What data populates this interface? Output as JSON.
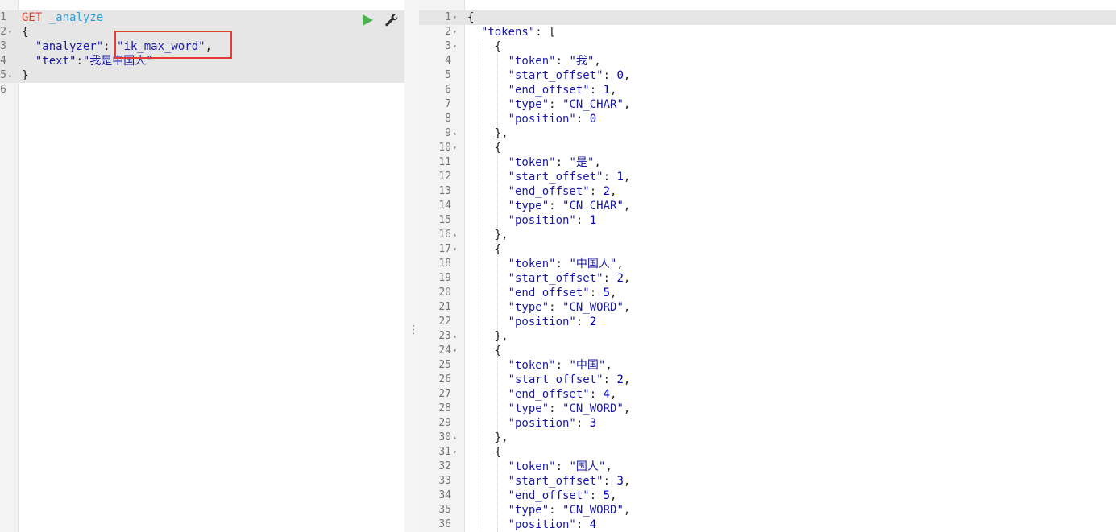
{
  "request": {
    "lines": [
      {
        "num": "1",
        "fold": "",
        "tokens": [
          [
            "method",
            "GET"
          ],
          [
            "punc",
            " "
          ],
          [
            "path",
            "_analyze"
          ]
        ]
      },
      {
        "num": "2",
        "fold": "▾",
        "tokens": [
          [
            "punc",
            "{"
          ]
        ]
      },
      {
        "num": "3",
        "fold": "",
        "tokens": [
          [
            "punc",
            "  "
          ],
          [
            "key",
            "\"analyzer\""
          ],
          [
            "punc",
            ": "
          ],
          [
            "str",
            "\"ik_max_word\""
          ],
          [
            "punc",
            ","
          ]
        ]
      },
      {
        "num": "4",
        "fold": "",
        "tokens": [
          [
            "punc",
            "  "
          ],
          [
            "key",
            "\"text\""
          ],
          [
            "punc",
            ":"
          ],
          [
            "str",
            "\"我是中国人\""
          ]
        ]
      },
      {
        "num": "5",
        "fold": "▴",
        "tokens": [
          [
            "punc",
            "}"
          ]
        ]
      },
      {
        "num": "6",
        "fold": "",
        "tokens": []
      }
    ]
  },
  "response": {
    "lines": [
      {
        "num": "1",
        "fold": "▾",
        "tokens": [
          [
            "punc",
            "{"
          ]
        ]
      },
      {
        "num": "2",
        "fold": "▾",
        "tokens": [
          [
            "punc",
            "  "
          ],
          [
            "key",
            "\"tokens\""
          ],
          [
            "punc",
            ": ["
          ]
        ]
      },
      {
        "num": "3",
        "fold": "▾",
        "tokens": [
          [
            "punc",
            "    {"
          ]
        ]
      },
      {
        "num": "4",
        "fold": "",
        "tokens": [
          [
            "punc",
            "      "
          ],
          [
            "key",
            "\"token\""
          ],
          [
            "punc",
            ": "
          ],
          [
            "str",
            "\"我\""
          ],
          [
            "punc",
            ","
          ]
        ]
      },
      {
        "num": "5",
        "fold": "",
        "tokens": [
          [
            "punc",
            "      "
          ],
          [
            "key",
            "\"start_offset\""
          ],
          [
            "punc",
            ": "
          ],
          [
            "num",
            "0"
          ],
          [
            "punc",
            ","
          ]
        ]
      },
      {
        "num": "6",
        "fold": "",
        "tokens": [
          [
            "punc",
            "      "
          ],
          [
            "key",
            "\"end_offset\""
          ],
          [
            "punc",
            ": "
          ],
          [
            "num",
            "1"
          ],
          [
            "punc",
            ","
          ]
        ]
      },
      {
        "num": "7",
        "fold": "",
        "tokens": [
          [
            "punc",
            "      "
          ],
          [
            "key",
            "\"type\""
          ],
          [
            "punc",
            ": "
          ],
          [
            "str",
            "\"CN_CHAR\""
          ],
          [
            "punc",
            ","
          ]
        ]
      },
      {
        "num": "8",
        "fold": "",
        "tokens": [
          [
            "punc",
            "      "
          ],
          [
            "key",
            "\"position\""
          ],
          [
            "punc",
            ": "
          ],
          [
            "num",
            "0"
          ]
        ]
      },
      {
        "num": "9",
        "fold": "▴",
        "tokens": [
          [
            "punc",
            "    },"
          ]
        ]
      },
      {
        "num": "10",
        "fold": "▾",
        "tokens": [
          [
            "punc",
            "    {"
          ]
        ]
      },
      {
        "num": "11",
        "fold": "",
        "tokens": [
          [
            "punc",
            "      "
          ],
          [
            "key",
            "\"token\""
          ],
          [
            "punc",
            ": "
          ],
          [
            "str",
            "\"是\""
          ],
          [
            "punc",
            ","
          ]
        ]
      },
      {
        "num": "12",
        "fold": "",
        "tokens": [
          [
            "punc",
            "      "
          ],
          [
            "key",
            "\"start_offset\""
          ],
          [
            "punc",
            ": "
          ],
          [
            "num",
            "1"
          ],
          [
            "punc",
            ","
          ]
        ]
      },
      {
        "num": "13",
        "fold": "",
        "tokens": [
          [
            "punc",
            "      "
          ],
          [
            "key",
            "\"end_offset\""
          ],
          [
            "punc",
            ": "
          ],
          [
            "num",
            "2"
          ],
          [
            "punc",
            ","
          ]
        ]
      },
      {
        "num": "14",
        "fold": "",
        "tokens": [
          [
            "punc",
            "      "
          ],
          [
            "key",
            "\"type\""
          ],
          [
            "punc",
            ": "
          ],
          [
            "str",
            "\"CN_CHAR\""
          ],
          [
            "punc",
            ","
          ]
        ]
      },
      {
        "num": "15",
        "fold": "",
        "tokens": [
          [
            "punc",
            "      "
          ],
          [
            "key",
            "\"position\""
          ],
          [
            "punc",
            ": "
          ],
          [
            "num",
            "1"
          ]
        ]
      },
      {
        "num": "16",
        "fold": "▴",
        "tokens": [
          [
            "punc",
            "    },"
          ]
        ]
      },
      {
        "num": "17",
        "fold": "▾",
        "tokens": [
          [
            "punc",
            "    {"
          ]
        ]
      },
      {
        "num": "18",
        "fold": "",
        "tokens": [
          [
            "punc",
            "      "
          ],
          [
            "key",
            "\"token\""
          ],
          [
            "punc",
            ": "
          ],
          [
            "str",
            "\"中国人\""
          ],
          [
            "punc",
            ","
          ]
        ]
      },
      {
        "num": "19",
        "fold": "",
        "tokens": [
          [
            "punc",
            "      "
          ],
          [
            "key",
            "\"start_offset\""
          ],
          [
            "punc",
            ": "
          ],
          [
            "num",
            "2"
          ],
          [
            "punc",
            ","
          ]
        ]
      },
      {
        "num": "20",
        "fold": "",
        "tokens": [
          [
            "punc",
            "      "
          ],
          [
            "key",
            "\"end_offset\""
          ],
          [
            "punc",
            ": "
          ],
          [
            "num",
            "5"
          ],
          [
            "punc",
            ","
          ]
        ]
      },
      {
        "num": "21",
        "fold": "",
        "tokens": [
          [
            "punc",
            "      "
          ],
          [
            "key",
            "\"type\""
          ],
          [
            "punc",
            ": "
          ],
          [
            "str",
            "\"CN_WORD\""
          ],
          [
            "punc",
            ","
          ]
        ]
      },
      {
        "num": "22",
        "fold": "",
        "tokens": [
          [
            "punc",
            "      "
          ],
          [
            "key",
            "\"position\""
          ],
          [
            "punc",
            ": "
          ],
          [
            "num",
            "2"
          ]
        ]
      },
      {
        "num": "23",
        "fold": "▴",
        "tokens": [
          [
            "punc",
            "    },"
          ]
        ]
      },
      {
        "num": "24",
        "fold": "▾",
        "tokens": [
          [
            "punc",
            "    {"
          ]
        ]
      },
      {
        "num": "25",
        "fold": "",
        "tokens": [
          [
            "punc",
            "      "
          ],
          [
            "key",
            "\"token\""
          ],
          [
            "punc",
            ": "
          ],
          [
            "str",
            "\"中国\""
          ],
          [
            "punc",
            ","
          ]
        ]
      },
      {
        "num": "26",
        "fold": "",
        "tokens": [
          [
            "punc",
            "      "
          ],
          [
            "key",
            "\"start_offset\""
          ],
          [
            "punc",
            ": "
          ],
          [
            "num",
            "2"
          ],
          [
            "punc",
            ","
          ]
        ]
      },
      {
        "num": "27",
        "fold": "",
        "tokens": [
          [
            "punc",
            "      "
          ],
          [
            "key",
            "\"end_offset\""
          ],
          [
            "punc",
            ": "
          ],
          [
            "num",
            "4"
          ],
          [
            "punc",
            ","
          ]
        ]
      },
      {
        "num": "28",
        "fold": "",
        "tokens": [
          [
            "punc",
            "      "
          ],
          [
            "key",
            "\"type\""
          ],
          [
            "punc",
            ": "
          ],
          [
            "str",
            "\"CN_WORD\""
          ],
          [
            "punc",
            ","
          ]
        ]
      },
      {
        "num": "29",
        "fold": "",
        "tokens": [
          [
            "punc",
            "      "
          ],
          [
            "key",
            "\"position\""
          ],
          [
            "punc",
            ": "
          ],
          [
            "num",
            "3"
          ]
        ]
      },
      {
        "num": "30",
        "fold": "▴",
        "tokens": [
          [
            "punc",
            "    },"
          ]
        ]
      },
      {
        "num": "31",
        "fold": "▾",
        "tokens": [
          [
            "punc",
            "    {"
          ]
        ]
      },
      {
        "num": "32",
        "fold": "",
        "tokens": [
          [
            "punc",
            "      "
          ],
          [
            "key",
            "\"token\""
          ],
          [
            "punc",
            ": "
          ],
          [
            "str",
            "\"国人\""
          ],
          [
            "punc",
            ","
          ]
        ]
      },
      {
        "num": "33",
        "fold": "",
        "tokens": [
          [
            "punc",
            "      "
          ],
          [
            "key",
            "\"start_offset\""
          ],
          [
            "punc",
            ": "
          ],
          [
            "num",
            "3"
          ],
          [
            "punc",
            ","
          ]
        ]
      },
      {
        "num": "34",
        "fold": "",
        "tokens": [
          [
            "punc",
            "      "
          ],
          [
            "key",
            "\"end_offset\""
          ],
          [
            "punc",
            ": "
          ],
          [
            "num",
            "5"
          ],
          [
            "punc",
            ","
          ]
        ]
      },
      {
        "num": "35",
        "fold": "",
        "tokens": [
          [
            "punc",
            "      "
          ],
          [
            "key",
            "\"type\""
          ],
          [
            "punc",
            ": "
          ],
          [
            "str",
            "\"CN_WORD\""
          ],
          [
            "punc",
            ","
          ]
        ]
      },
      {
        "num": "36",
        "fold": "",
        "tokens": [
          [
            "punc",
            "      "
          ],
          [
            "key",
            "\"position\""
          ],
          [
            "punc",
            ": "
          ],
          [
            "num",
            "4"
          ]
        ]
      }
    ]
  },
  "toolbar": {
    "run_icon": "play-icon",
    "settings_icon": "wrench-icon"
  },
  "divider": {
    "handle_glyph": "⋮"
  },
  "colors": {
    "method": "#e0402b",
    "path": "#2f9fd6",
    "string": "#1a1aa6",
    "number": "#0000cc",
    "highlight_box": "#e53935",
    "run_green": "#4caf50"
  }
}
